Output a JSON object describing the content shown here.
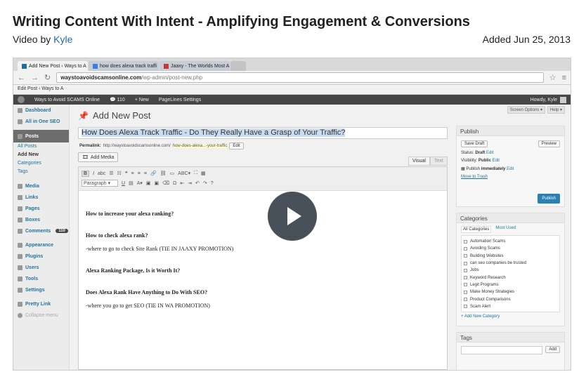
{
  "header": {
    "title": "Writing Content With Intent - Amplifying Engagement & Conversions",
    "video_by_prefix": "Video by",
    "author": "Kyle",
    "added": "Added Jun 25, 2013"
  },
  "browser": {
    "tabs": [
      {
        "label": "Add New Post ‹ Ways to A",
        "active": true
      },
      {
        "label": "how does alexa track traffi",
        "active": false
      },
      {
        "label": "Jaaxy - The Worlds Most A",
        "active": false
      }
    ],
    "url_host": "waystoavoidscamsonline.com",
    "url_path": "/wp-admin/post-new.php",
    "bookmark": "Edit Post ‹ Ways to A"
  },
  "adminbar": {
    "site": "Ways to Avoid SCAMS Online",
    "comments": "110",
    "new": "+ New",
    "settings": "PageLines Settings",
    "howdy": "Howdy, Kyle"
  },
  "menu": {
    "top": [
      {
        "label": "Dashboard",
        "icon": "dashboard-icon"
      },
      {
        "label": "All in One SEO",
        "icon": "seo-icon"
      }
    ],
    "posts": "Posts",
    "posts_sub": [
      "All Posts",
      "Add New",
      "Categories",
      "Tags"
    ],
    "items": [
      {
        "label": "Media",
        "icon": "media-icon"
      },
      {
        "label": "Links",
        "icon": "links-icon"
      },
      {
        "label": "Pages",
        "icon": "pages-icon"
      },
      {
        "label": "Boxes",
        "icon": "boxes-icon"
      },
      {
        "label": "Comments",
        "icon": "comments-icon",
        "count": "110"
      }
    ],
    "items2": [
      {
        "label": "Appearance",
        "icon": "appearance-icon"
      },
      {
        "label": "Plugins",
        "icon": "plugins-icon"
      },
      {
        "label": "Users",
        "icon": "users-icon"
      },
      {
        "label": "Tools",
        "icon": "tools-icon"
      },
      {
        "label": "Settings",
        "icon": "settings-icon"
      }
    ],
    "pretty_link": "Pretty Link",
    "collapse": "Collapse menu"
  },
  "editor": {
    "page_title": "Add New Post",
    "screen_options": "Screen Options ▾",
    "help": "Help ▾",
    "post_title": "How Does Alexa Track Traffic - Do They Really Have a Grasp of Your Traffic?",
    "permalink_label": "Permalink:",
    "permalink_base": "http://waystoavoidscamsonline.com/",
    "permalink_slug": "how-does-alexa...-your-traffic",
    "edit": "Edit",
    "add_media": "Add Media",
    "visual": "Visual",
    "text": "Text",
    "format": "Paragraph",
    "body": [
      {
        "type": "h",
        "text": "How to increase your alexa ranking?"
      },
      {
        "type": "h",
        "text": "How to check alexa rank?"
      },
      {
        "type": "p",
        "text": "-where to go to check Site Rank (TIE IN JAAXY PROMOTION)"
      },
      {
        "type": "h",
        "text": "Alexa Ranking Package, Is it Worth It?"
      },
      {
        "type": "h",
        "text": "Does Alexa Rank Have Anything to Do With SEO?"
      },
      {
        "type": "p",
        "text": "-where you go to get SEO (TIE IN WA PROMOTION)"
      }
    ]
  },
  "publish": {
    "title": "Publish",
    "save_draft": "Save Draft",
    "preview": "Preview",
    "status_label": "Status:",
    "status": "Draft",
    "visibility_label": "Visibility:",
    "visibility": "Public",
    "publish_label": "Publish",
    "publish_when": "immediately",
    "edit": "Edit",
    "trash": "Move to Trash",
    "button": "Publish"
  },
  "categories": {
    "title": "Categories",
    "tab_all": "All Categories",
    "tab_used": "Most Used",
    "items": [
      "Automation Scams",
      "Avoiding Scams",
      "Building Websites",
      "can seo companies be trusted",
      "Jobs",
      "Keyword Research",
      "Legit Programs",
      "Make Money Strategies",
      "Product Comparisons",
      "Scam Alert"
    ],
    "add": "+ Add New Category"
  },
  "tags": {
    "title": "Tags",
    "add": "Add"
  },
  "colors": {
    "accent": "#21759b",
    "publish": "#2a7fb5",
    "adminbar": "#464646"
  }
}
